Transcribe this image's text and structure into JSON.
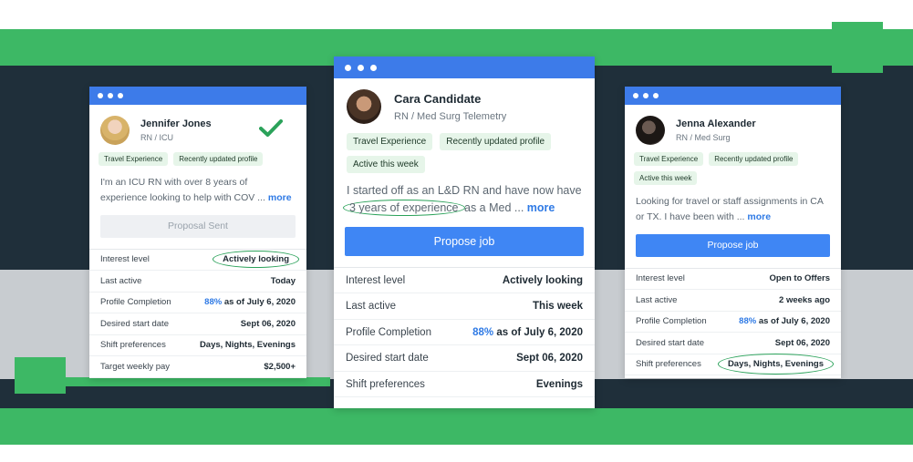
{
  "colors": {
    "green_band": "#3db865",
    "dark_band": "#1f2f3a",
    "titlebar_blue": "#3d7be9",
    "button_blue": "#3f86f4",
    "tag_bg": "#e6f5e9",
    "link_blue": "#2f7ae5",
    "check_green": "#2ba25a"
  },
  "cards": [
    {
      "name": "Jennifer Jones",
      "role": "RN / ICU",
      "avatar_icon": "profile-photo",
      "status_icon": "checkmark-icon",
      "tags": [
        "Travel Experience",
        "Recently updated profile"
      ],
      "description": "I'm an ICU RN with over 8 years of experience looking to help with COV ...",
      "more": "more",
      "button": "Proposal Sent",
      "rows": [
        {
          "label": "Interest level",
          "value": "Actively looking"
        },
        {
          "label": "Last active",
          "value": "Today"
        },
        {
          "label": "Profile Completion",
          "pct": "88%",
          "value": "as of July 6, 2020"
        },
        {
          "label": "Desired start date",
          "value": "Sept 06, 2020"
        },
        {
          "label": "Shift preferences",
          "value": "Days, Nights, Evenings"
        },
        {
          "label": "Target weekly pay",
          "value": "$2,500+"
        }
      ]
    },
    {
      "name": "Cara Candidate",
      "role": "RN / Med Surg Telemetry",
      "avatar_icon": "profile-photo",
      "tags": [
        "Travel Experience",
        "Recently updated profile",
        "Active this week"
      ],
      "description_part1": "I started off as an L&D RN and have now have",
      "description_highlight": "3 years of experience",
      "description_part2": "as a Med ...",
      "more": "more",
      "button": "Propose job",
      "rows": [
        {
          "label": "Interest level",
          "value": "Actively looking"
        },
        {
          "label": "Last active",
          "value": "This week"
        },
        {
          "label": "Profile Completion",
          "pct": "88%",
          "value": "as of July 6, 2020"
        },
        {
          "label": "Desired start date",
          "value": "Sept 06, 2020"
        },
        {
          "label": "Shift preferences",
          "value": "Evenings"
        }
      ]
    },
    {
      "name": "Jenna Alexander",
      "role": "RN / Med Surg",
      "avatar_icon": "profile-photo",
      "tags": [
        "Travel Experience",
        "Recently updated profile",
        "Active this week"
      ],
      "description": "Looking for travel or staff assignments in CA or TX. I have been with ...",
      "more": "more",
      "button": "Propose job",
      "rows": [
        {
          "label": "Interest level",
          "value": "Open to Offers"
        },
        {
          "label": "Last active",
          "value": "2 weeks ago"
        },
        {
          "label": "Profile Completion",
          "pct": "88%",
          "value": "as of July 6, 2020"
        },
        {
          "label": "Desired start date",
          "value": "Sept 06, 2020"
        },
        {
          "label": "Shift preferences",
          "value": "Days, Nights, Evenings"
        }
      ]
    }
  ]
}
